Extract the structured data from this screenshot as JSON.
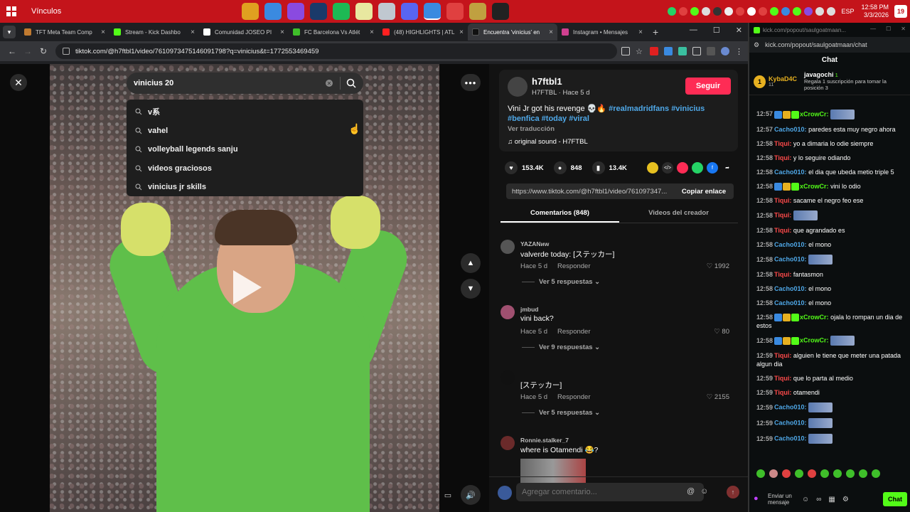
{
  "taskbar": {
    "title": "Vínculos",
    "language": "ESP",
    "time": "12:58 PM",
    "date": "3/3/2026",
    "notification_count": "19",
    "colors": {
      "background": "#c4141b"
    }
  },
  "browser": {
    "tabs": [
      {
        "label": "TFT Meta Team Comp",
        "color": "#c07a30"
      },
      {
        "label": "Stream - Kick Dashbo",
        "color": "#53fc18"
      },
      {
        "label": "Comunidad JOSEO PI",
        "color": "#ffffff"
      },
      {
        "label": "FC Barcelona Vs Atlét",
        "color": "#3fbf2a"
      },
      {
        "label": "(48) HIGHLIGHTS | ATL",
        "color": "#ff2020"
      },
      {
        "label": "Encuentra 'vinicius' en",
        "color": "#111111"
      },
      {
        "label": "Instagram • Mensajes",
        "color": "#d04090"
      }
    ],
    "url": "tiktok.com/@h7ftbl1/video/7610973475146091798?q=vinicius&t=1772553469459"
  },
  "search": {
    "value": "vinicius 20",
    "suggestions": [
      "v系",
      "vahel",
      "volleyball legends sanju",
      "videos graciosos",
      "vinicius jr skills"
    ]
  },
  "post": {
    "author": "h7ftbl1",
    "author_sub": "H7FTBL · Hace 5 d",
    "follow_label": "Seguir",
    "description_text": "Vini Jr got his revenge 💀🔥",
    "hashtags": "#realmadridfans #vinicius #benfica #today #viral",
    "translate_label": "Ver traducción",
    "sound": "original sound - H7FTBL",
    "likes": "153.4K",
    "comments_count": "848",
    "saves": "13.4K",
    "link": "https://www.tiktok.com/@h7ftbl1/video/761097347...",
    "copy_label": "Copiar enlace",
    "tab_comments": "Comentarios (848)",
    "tab_creator": "Videos del creador",
    "comment_placeholder": "Agregar comentario..."
  },
  "comments": [
    {
      "user": "YAZANиw",
      "text": "valverde today: [ステッカー]",
      "time": "Hace 5 d",
      "reply": "Responder",
      "likes": "1992",
      "replies": "Ver 5 respuestas"
    },
    {
      "user": "jmbud",
      "text": "vini back?",
      "time": "Hace 5 d",
      "reply": "Responder",
      "likes": "80",
      "replies": "Ver 9 respuestas"
    },
    {
      "user": "",
      "text": "[ステッカー]",
      "time": "Hace 5 d",
      "reply": "Responder",
      "likes": "2155",
      "replies": "Ver 5 respuestas"
    },
    {
      "user": "Ronnie.stalker_7",
      "text": "where is Otamendi 😂?",
      "time": "",
      "reply": "",
      "likes": "",
      "replies": ""
    }
  ],
  "kick": {
    "url": "kick.com/popout/saulgoatmaan/chat",
    "window_url": "kick.com/popout/saulgoatmaan...",
    "chat_title": "Chat",
    "pinned_user": "KybaD4C",
    "pinned_level": "11",
    "gift_user": "javagochi",
    "gift_count": "1",
    "gift_text": "Regala 1 suscripción para tomar la posición 3",
    "send_label": "Enviar un mensaje",
    "chat_button": "Chat",
    "messages": [
      {
        "time": "12:57",
        "user": "xCrowCr:",
        "color": "#53fc18",
        "text": ""
      },
      {
        "time": "12:57",
        "user": "Cacho010:",
        "color": "#4fa8e8",
        "text": "paredes esta muy negro ahora"
      },
      {
        "time": "12:58",
        "user": "Tiqui:",
        "color": "#ff4a4a",
        "text": "yo a dimaria lo odie siempre"
      },
      {
        "time": "12:58",
        "user": "Tiqui:",
        "color": "#ff4a4a",
        "text": "y lo seguire odiando"
      },
      {
        "time": "12:58",
        "user": "Cacho010:",
        "color": "#4fa8e8",
        "text": "el dia que ubeda metio triple 5"
      },
      {
        "time": "12:58",
        "user": "xCrowCr:",
        "color": "#53fc18",
        "text": "vini lo odio"
      },
      {
        "time": "12:58",
        "user": "Tiqui:",
        "color": "#ff4a4a",
        "text": "sacame el negro feo ese"
      },
      {
        "time": "12:58",
        "user": "Tiqui:",
        "color": "#ff4a4a",
        "text": ""
      },
      {
        "time": "12:58",
        "user": "Tiqui:",
        "color": "#ff4a4a",
        "text": "que agrandado es"
      },
      {
        "time": "12:58",
        "user": "Cacho010:",
        "color": "#4fa8e8",
        "text": "el mono"
      },
      {
        "time": "12:58",
        "user": "Cacho010:",
        "color": "#4fa8e8",
        "text": ""
      },
      {
        "time": "12:58",
        "user": "Tiqui:",
        "color": "#ff4a4a",
        "text": "fantasmon"
      },
      {
        "time": "12:58",
        "user": "Cacho010:",
        "color": "#4fa8e8",
        "text": "el mono"
      },
      {
        "time": "12:58",
        "user": "Cacho010:",
        "color": "#4fa8e8",
        "text": "el mono"
      },
      {
        "time": "12:58",
        "user": "xCrowCr:",
        "color": "#53fc18",
        "text": "ojala lo rompan un dia de estos"
      },
      {
        "time": "12:58",
        "user": "xCrowCr:",
        "color": "#53fc18",
        "text": ""
      },
      {
        "time": "12:59",
        "user": "Tiqui:",
        "color": "#ff4a4a",
        "text": "alguien le tiene que meter una patada algun dia"
      },
      {
        "time": "12:59",
        "user": "Tiqui:",
        "color": "#ff4a4a",
        "text": "que lo parta al medio"
      },
      {
        "time": "12:59",
        "user": "Tiqui:",
        "color": "#ff4a4a",
        "text": "otamendi"
      },
      {
        "time": "12:59",
        "user": "Cacho010:",
        "color": "#4fa8e8",
        "text": ""
      },
      {
        "time": "12:59",
        "user": "Cacho010:",
        "color": "#4fa8e8",
        "text": ""
      },
      {
        "time": "12:59",
        "user": "Cacho010:",
        "color": "#4fa8e8",
        "text": ""
      }
    ]
  },
  "colors": {
    "accent": "#fe2c55",
    "hashtag": "#4fa8e8",
    "kick_green": "#53fc18"
  }
}
